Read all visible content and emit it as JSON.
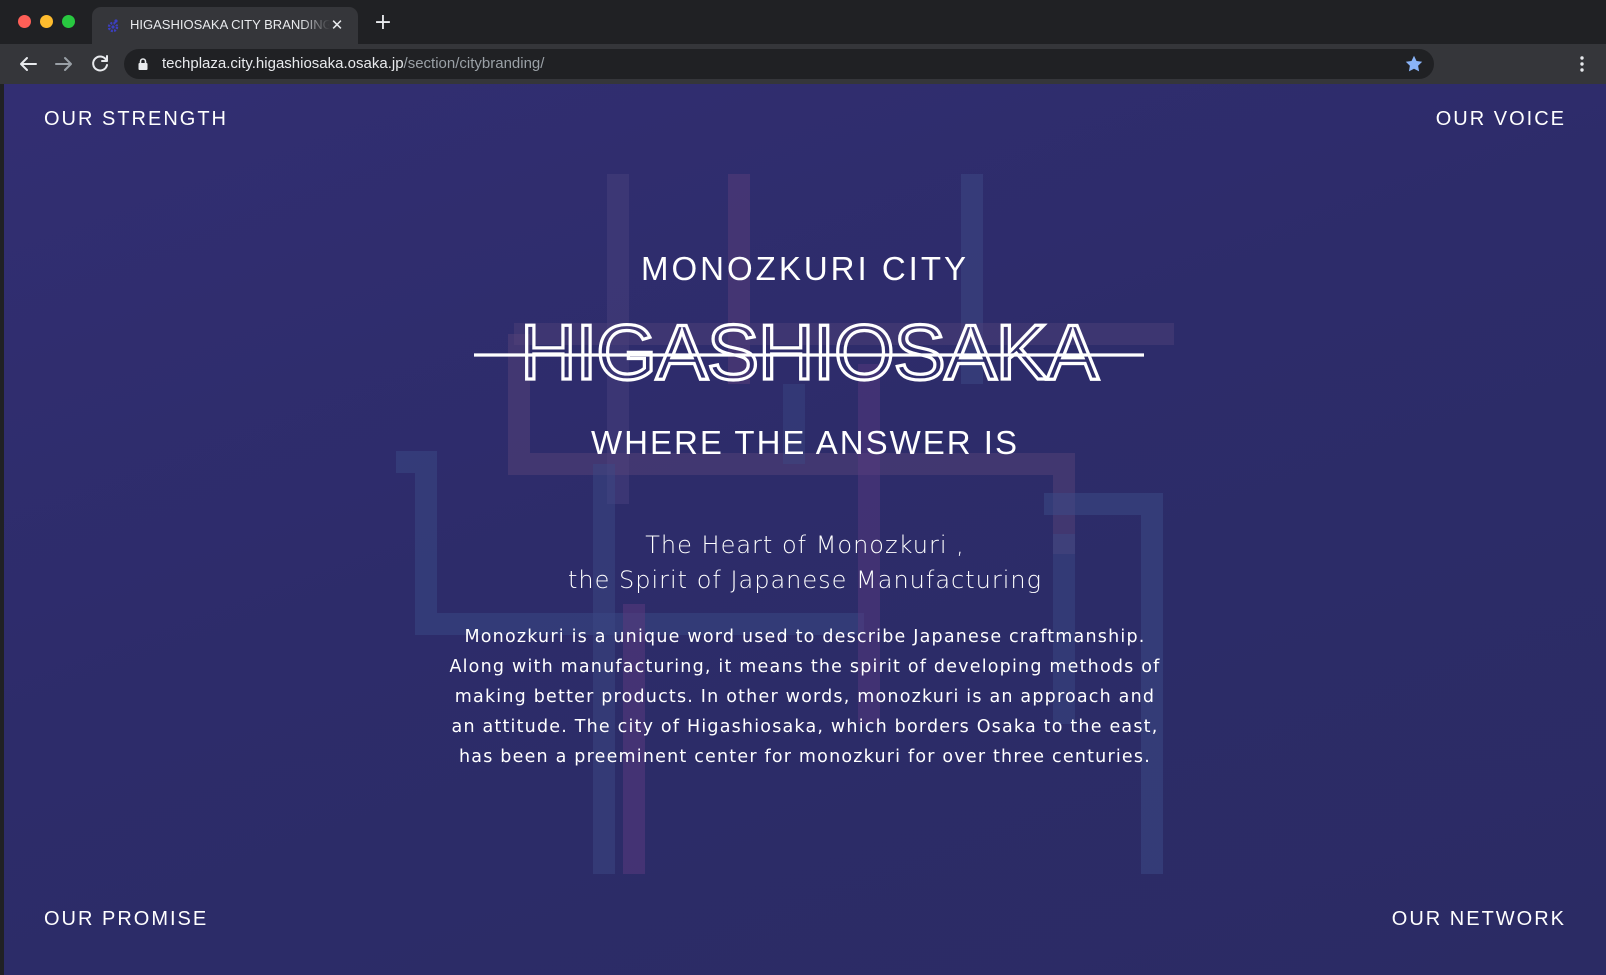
{
  "browser": {
    "tab": {
      "title": "HIGASHIOSAKA CITY BRANDING",
      "favicon": "gear-people-icon"
    },
    "address": {
      "host": "techplaza.city.higashiosaka.osaka.jp",
      "path": "/section/citybranding/"
    }
  },
  "page": {
    "nav": {
      "top_left": "OUR STRENGTH",
      "top_right": "OUR VOICE",
      "bottom_left": "OUR PROMISE",
      "bottom_right": "OUR NETWORK"
    },
    "kicker": "MONOZKURI CITY",
    "logo_text": "HIGASHIOSAKA",
    "tagline": "WHERE THE ANSWER IS",
    "heading_line1": "The Heart of Monozkuri ,",
    "heading_line2": "the Spirit of Japanese Manufacturing",
    "body": "Monozkuri is a unique word used to describe Japanese craftmanship. Along with manufacturing, it means the spirit of developing methods of making better products. In other words, monozkuri is an approach and an attitude. The city of Higashiosaka, which borders Osaka to the east, has been a preeminent center for monozkuri for over three centuries."
  },
  "colors": {
    "page_background": "#2d2c6a",
    "chrome_dark": "#202124",
    "chrome_toolbar": "#35363a",
    "accent_star": "#8ab4f8",
    "text": "#ffffff"
  }
}
